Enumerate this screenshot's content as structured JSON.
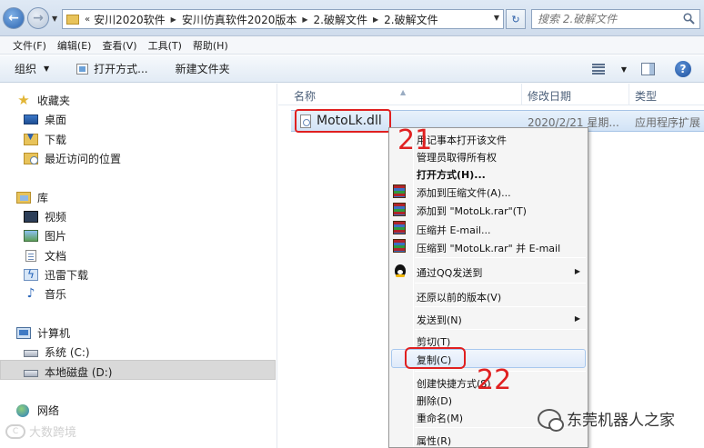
{
  "address_bar": {
    "chevrons": "«",
    "breadcrumbs": [
      "安川2020软件",
      "安川仿真软件2020版本",
      "2.破解文件",
      "2.破解文件"
    ],
    "search_placeholder": "搜索 2.破解文件"
  },
  "menu_bar": [
    "文件(F)",
    "编辑(E)",
    "查看(V)",
    "工具(T)",
    "帮助(H)"
  ],
  "toolbar": {
    "organize": "组织",
    "open_with": "打开方式...",
    "new_folder": "新建文件夹"
  },
  "nav_pane": {
    "favorites": {
      "label": "收藏夹",
      "items": [
        "桌面",
        "下载",
        "最近访问的位置"
      ]
    },
    "libraries": {
      "label": "库",
      "items": [
        "视频",
        "图片",
        "文档",
        "迅雷下载",
        "音乐"
      ]
    },
    "computer": {
      "label": "计算机",
      "items": [
        "系统 (C:)",
        "本地磁盘 (D:)"
      ]
    },
    "network": {
      "label": "网络"
    }
  },
  "columns": {
    "name": "名称",
    "modified": "修改日期",
    "type": "类型"
  },
  "file": {
    "name": "MotoLk.dll",
    "modified": "2020/2/21 星期...",
    "type": "应用程序扩展"
  },
  "context_menu": {
    "items": [
      "用记事本打开该文件",
      "管理员取得所有权",
      "打开方式(H)...",
      "添加到压缩文件(A)...",
      "添加到 \"MotoLk.rar\"(T)",
      "压缩并 E-mail...",
      "压缩到 \"MotoLk.rar\" 并 E-mail",
      "通过QQ发送到",
      "还原以前的版本(V)",
      "发送到(N)",
      "剪切(T)",
      "复制(C)",
      "创建快捷方式(S)",
      "删除(D)",
      "重命名(M)",
      "属性(R)"
    ]
  },
  "annotations": {
    "step1": "21",
    "step2": "22"
  },
  "watermarks": {
    "left": "大数跨境",
    "right": "东莞机器人之家"
  },
  "colors": {
    "highlight_red": "#e02020",
    "selection_blue": "#d2e3f6"
  }
}
